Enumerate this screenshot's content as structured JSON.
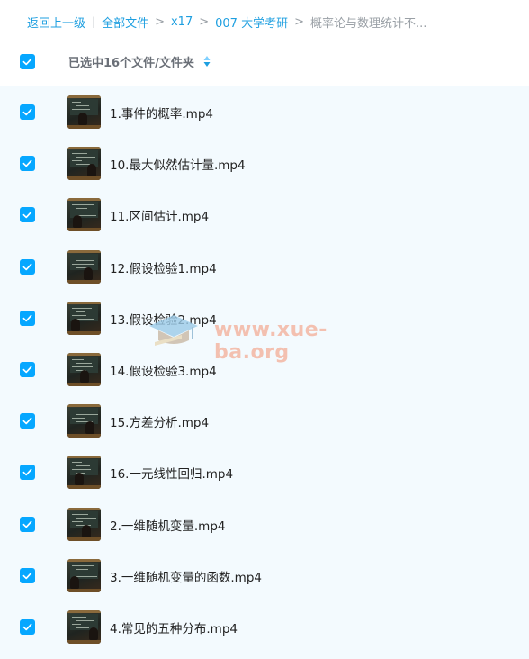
{
  "breadcrumb": {
    "back": "返回上一级",
    "root": "全部文件",
    "level1": "x17",
    "level2": "007 大学考研",
    "current": "概率论与数理统计不...",
    "separator": "|",
    "arrow": ">"
  },
  "header": {
    "selection_text": "已选中16个文件/文件夹",
    "checked": true
  },
  "files": [
    {
      "name": "1.事件的概率.mp4",
      "checked": true
    },
    {
      "name": "10.最大似然估计量.mp4",
      "checked": true
    },
    {
      "name": "11.区间估计.mp4",
      "checked": true
    },
    {
      "name": "12.假设检验1.mp4",
      "checked": true
    },
    {
      "name": "13.假设检验2.mp4",
      "checked": true
    },
    {
      "name": "14.假设检验3.mp4",
      "checked": true
    },
    {
      "name": "15.方差分析.mp4",
      "checked": true
    },
    {
      "name": "16.一元线性回归.mp4",
      "checked": true
    },
    {
      "name": "2.一维随机变量.mp4",
      "checked": true
    },
    {
      "name": "3.一维随机变量的函数.mp4",
      "checked": true
    },
    {
      "name": "4.常见的五种分布.mp4",
      "checked": true
    }
  ],
  "watermark": {
    "text": "www.xue-ba.org"
  },
  "colors": {
    "accent": "#06a7ff",
    "link": "#1e9fe0",
    "list_background": "#f3fafe",
    "watermark": "#f4b6a3"
  },
  "icons": {
    "checkbox": "check-icon",
    "sort": "sort-icon",
    "thumbnail": "video-thumbnail"
  }
}
